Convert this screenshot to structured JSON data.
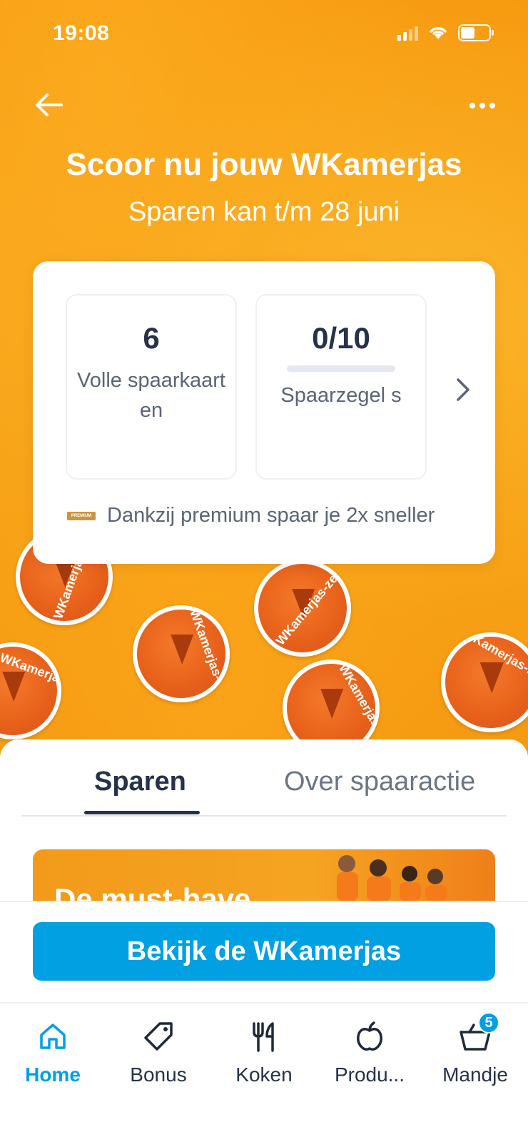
{
  "status_bar": {
    "time": "19:08"
  },
  "header": {
    "title": "Scoor nu jouw WKamerjas",
    "subtitle": "Sparen kan t/m 28 juni"
  },
  "stats": [
    {
      "value": "6",
      "label": "Volle spaarkaart en"
    },
    {
      "value": "0/10",
      "label": "Spaarzegel s",
      "progress": 0
    }
  ],
  "premium": {
    "badge": "PREMIUM",
    "text": "Dankzij premium spaar je 2x sneller"
  },
  "stamps": {
    "label": "WKamerjas-zegel"
  },
  "tabs": [
    {
      "label": "Sparen",
      "active": true
    },
    {
      "label": "Over spaaractie",
      "active": false
    }
  ],
  "promo": {
    "text": "De must-have"
  },
  "cta": {
    "label": "Bekijk de WKamerjas"
  },
  "tabbar": {
    "items": [
      {
        "label": "Home",
        "icon": "home-icon",
        "active": true
      },
      {
        "label": "Bonus",
        "icon": "tag-icon"
      },
      {
        "label": "Koken",
        "icon": "cutlery-icon"
      },
      {
        "label": "Produ...",
        "icon": "apple-icon"
      },
      {
        "label": "Mandje",
        "icon": "basket-icon",
        "badge": "5"
      }
    ]
  },
  "colors": {
    "accent": "#00a0e2",
    "orange": "#f7a21b",
    "text_dark": "#25324a"
  }
}
